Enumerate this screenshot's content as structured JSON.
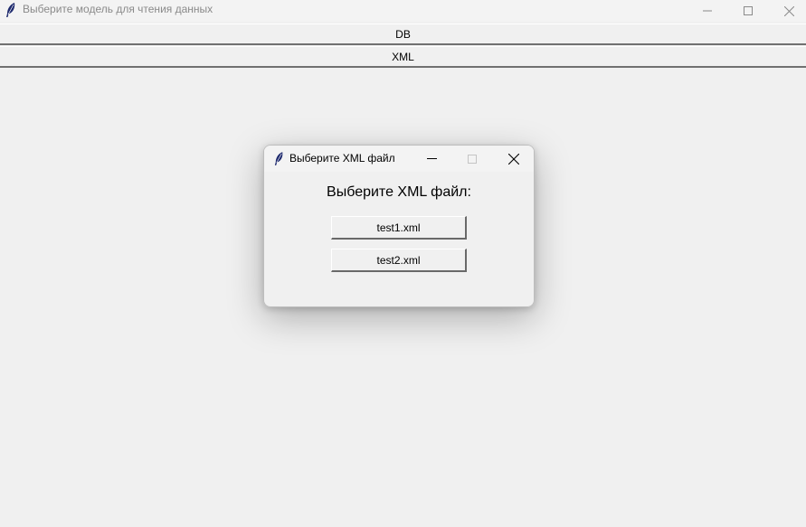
{
  "main_window": {
    "title": "Выберите модель для чтения данных",
    "icon": "feather-icon",
    "buttons": {
      "db_label": "DB",
      "xml_label": "XML"
    }
  },
  "dialog": {
    "title": "Выберите XML файл",
    "icon": "feather-icon",
    "heading": "Выберите XML файл:",
    "files": [
      {
        "label": "test1.xml"
      },
      {
        "label": "test2.xml"
      }
    ]
  },
  "colors": {
    "background": "#f0f0f0",
    "titlebar": "#f3f3f3",
    "inactive_title_text": "#8a8a8a",
    "button_shadow": "#696969"
  }
}
